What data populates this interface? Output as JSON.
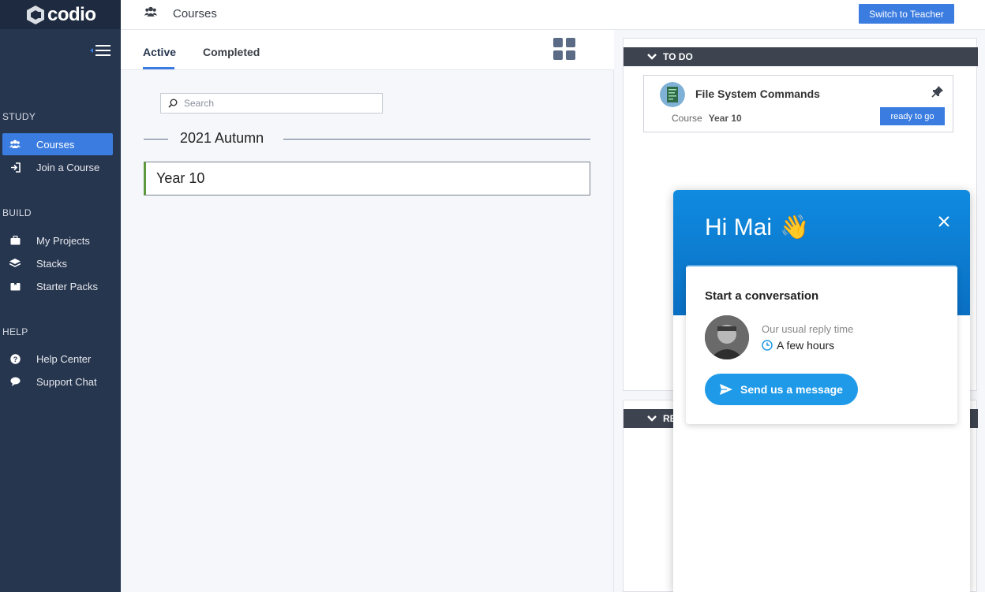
{
  "app": {
    "logo_text": "codio"
  },
  "sidebar": {
    "sections": [
      {
        "title": "STUDY",
        "items": [
          {
            "label": "Courses",
            "icon": "users-icon",
            "active": true
          },
          {
            "label": "Join a Course",
            "icon": "sign-in-icon"
          }
        ]
      },
      {
        "title": "BUILD",
        "items": [
          {
            "label": "My Projects",
            "icon": "briefcase-icon"
          },
          {
            "label": "Stacks",
            "icon": "layers-icon"
          },
          {
            "label": "Starter Packs",
            "icon": "package-icon"
          }
        ]
      },
      {
        "title": "HELP",
        "items": [
          {
            "label": "Help Center",
            "icon": "question-icon"
          },
          {
            "label": "Support Chat",
            "icon": "chat-bubble-icon"
          }
        ]
      }
    ]
  },
  "topbar": {
    "crumb": "Courses",
    "switch_label": "Switch to Teacher"
  },
  "tabs": [
    {
      "label": "Active",
      "active": true
    },
    {
      "label": "Completed"
    }
  ],
  "search": {
    "placeholder": "Search"
  },
  "term": {
    "label": "2021 Autumn"
  },
  "courses": [
    {
      "name": "Year 10"
    }
  ],
  "todo": {
    "header": "TO DO",
    "item": {
      "title": "File System Commands",
      "meta_label": "Course",
      "meta_value": "Year 10",
      "action": "ready to go"
    }
  },
  "recent": {
    "header": "RE"
  },
  "chat": {
    "greeting": "Hi Mai",
    "wave": "👋",
    "card_title": "Start a conversation",
    "reply_label": "Our usual reply time",
    "reply_value": "A few hours",
    "send_label": "Send us a message"
  },
  "colors": {
    "accent": "#3b7ce0",
    "sidebar": "#27364f",
    "chat_blue": "#0f8be0",
    "course_border": "#5d9a3e"
  }
}
